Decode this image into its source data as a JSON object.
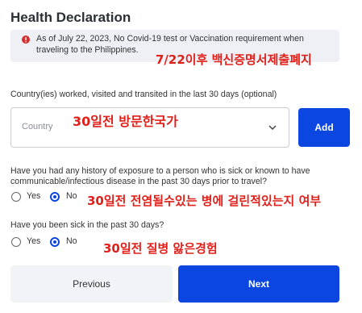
{
  "form": {
    "title": "Health Declaration",
    "alert": {
      "icon": "warning-triangle-icon",
      "message": "As of July 22, 2023, No Covid-19 test or Vaccination requirement when traveling to the Philippines."
    },
    "country": {
      "label": "Country(ies) worked, visited and transited in the last 30 days (optional)",
      "placeholder": "Country",
      "add_label": "Add"
    },
    "exposure": {
      "question": "Have you had any history of exposure to a person who is sick or known to have communicable/infectious disease in the past 30 days prior to travel?",
      "options": [
        "Yes",
        "No"
      ],
      "selected": "No"
    },
    "sick": {
      "question": "Have you been sick in the past 30 days?",
      "options": [
        "Yes",
        "No"
      ],
      "selected": "No"
    },
    "prev_label": "Previous",
    "next_label": "Next"
  },
  "annotations": {
    "a1": "7/22이후 백신증명서제출폐지",
    "a2": "30일전 방문한국가",
    "a3": "30일전 전염될수있는 병에 걸린적있는지 여부",
    "a4": "30일전 질병 앓은경험"
  },
  "colors": {
    "primary": "#0b46e0",
    "annotation": "#e0201a",
    "alert_bg": "#eef0f6"
  }
}
